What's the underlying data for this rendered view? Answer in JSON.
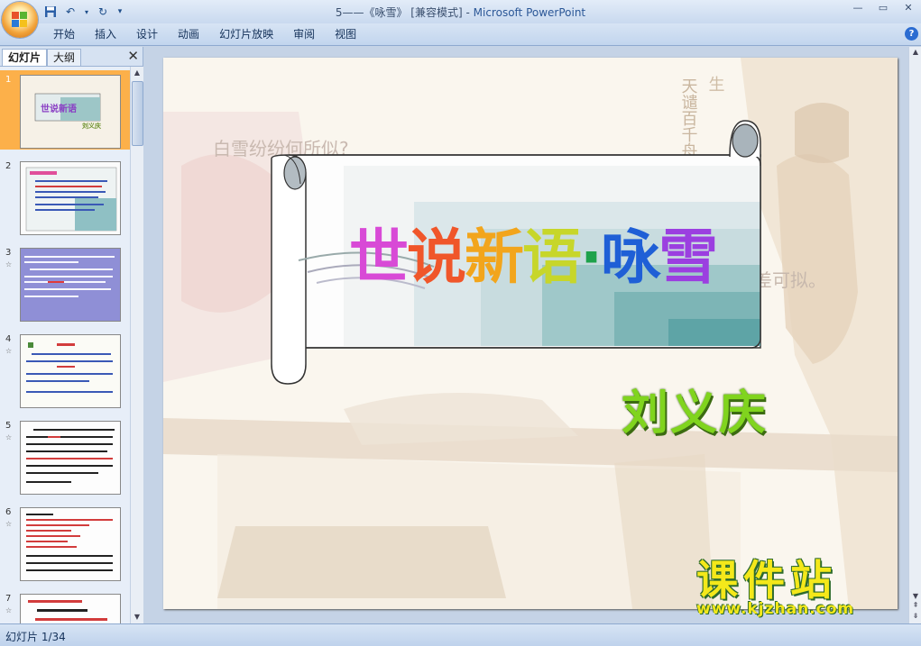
{
  "window": {
    "title_doc": "5——《咏雪》 [兼容模式]",
    "title_sep": " - ",
    "title_app": "Microsoft PowerPoint"
  },
  "ribbon": {
    "tabs": [
      "开始",
      "插入",
      "设计",
      "动画",
      "幻灯片放映",
      "审阅",
      "视图"
    ]
  },
  "panel": {
    "tab_slides": "幻灯片",
    "tab_outline": "大纲",
    "thumbs": [
      {
        "num": "1",
        "animated": false
      },
      {
        "num": "2",
        "animated": false
      },
      {
        "num": "3",
        "animated": true
      },
      {
        "num": "4",
        "animated": true
      },
      {
        "num": "5",
        "animated": true
      },
      {
        "num": "6",
        "animated": true
      },
      {
        "num": "7",
        "animated": true
      }
    ],
    "anim_mark": "☆"
  },
  "slide": {
    "bg_poem_left": "白雪纷纷何所似?",
    "bg_poem_right": "差可拟。",
    "title_chars": [
      "世",
      "说",
      "新",
      "语",
      "·",
      "咏",
      "雪"
    ],
    "title_colors": [
      "#d84ad6",
      "#f0562a",
      "#f2a51c",
      "#c7d62a",
      "#1ea24b",
      "#1f5fd6",
      "#9b3fe0"
    ],
    "author": "刘义庆"
  },
  "watermark": {
    "brand": "课件站",
    "url": "www.kjzhan.com"
  },
  "statusbar": {
    "slide_indicator": "幻灯片 1/34"
  },
  "colors": {
    "accent_selected": "#fcb04a",
    "ribbon_bg": "#c5d3e6"
  }
}
